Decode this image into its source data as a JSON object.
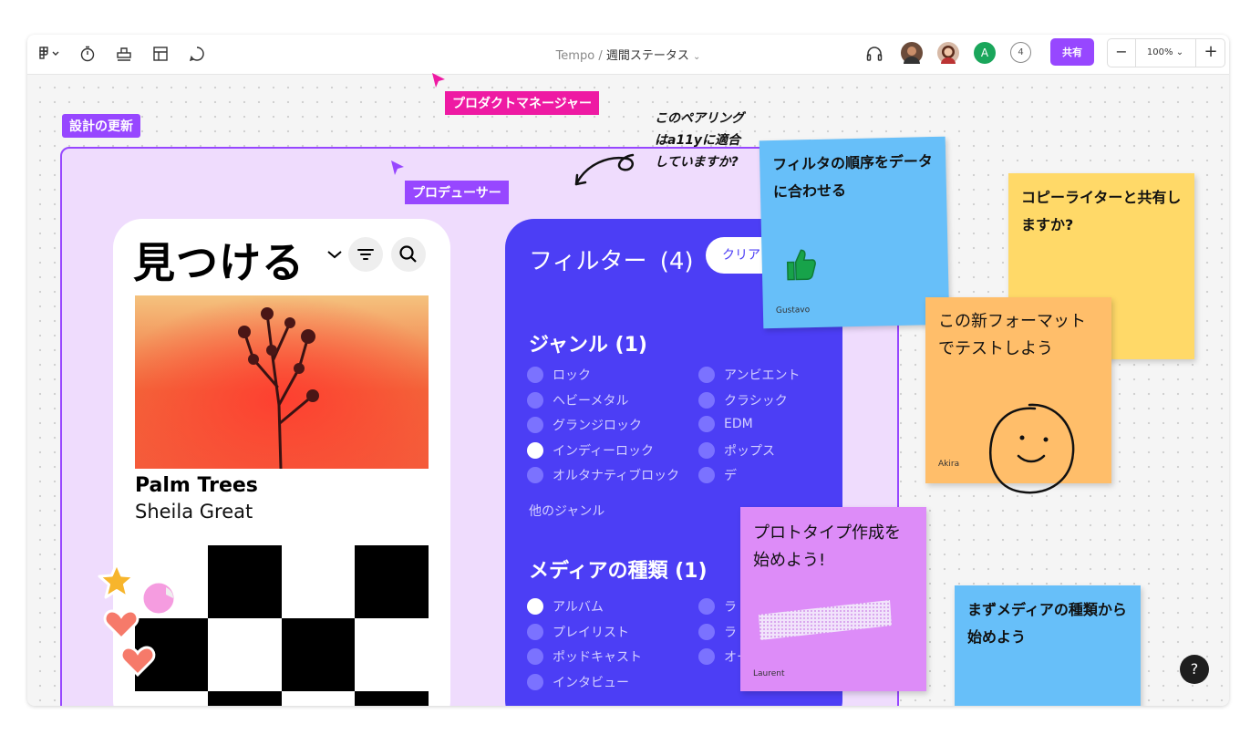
{
  "toolbar": {
    "file_name_prefix": "Tempo",
    "separator": "/",
    "file_name": "週間ステータス",
    "avatar_initial": "A",
    "viewer_count": "4",
    "share_label": "共有",
    "zoom_level": "100%",
    "zoom_out": "−",
    "zoom_in": "+"
  },
  "canvas": {
    "section_label": "設計の更新",
    "cursor_pm": "プロダクトマネージャー",
    "cursor_producer": "プロデューサー",
    "handwritten_note": [
      "このペアリング",
      "はa11yに適合",
      "していますか?"
    ]
  },
  "phone": {
    "heading": "見つける",
    "track_title": "Palm Trees",
    "track_artist": "Sheila Great"
  },
  "filter_panel": {
    "title": "フィルター",
    "count": "(4)",
    "clear_label": "クリア",
    "genre_heading": "ジャンル (1)",
    "genres_left": [
      {
        "label": "ロック",
        "on": false
      },
      {
        "label": "ヘビーメタル",
        "on": false
      },
      {
        "label": "グランジロック",
        "on": false
      },
      {
        "label": "インディーロック",
        "on": true
      },
      {
        "label": "オルタナティブロック",
        "on": false
      }
    ],
    "genres_right": [
      {
        "label": "アンビエント",
        "on": false
      },
      {
        "label": "クラシック",
        "on": false
      },
      {
        "label": "EDM",
        "on": false
      },
      {
        "label": "ポップス",
        "on": false
      },
      {
        "label": "デ",
        "on": false
      }
    ],
    "more_genres": "他のジャンル",
    "media_heading": "メディアの種類 (1)",
    "media_left": [
      {
        "label": "アルバム",
        "on": true
      },
      {
        "label": "プレイリスト",
        "on": false
      },
      {
        "label": "ポッドキャスト",
        "on": false
      },
      {
        "label": "インタビュー",
        "on": false
      }
    ],
    "media_right": [
      {
        "label": "ラ",
        "on": false
      },
      {
        "label": "ラ",
        "on": false
      },
      {
        "label": "オーディオブック",
        "on": false
      }
    ]
  },
  "stickies": {
    "blue_top": {
      "text": "フィルタの順序をデータに合わせる",
      "author": "Gustavo"
    },
    "yellow": {
      "text": "コピーライターと共有しますか?"
    },
    "orange": {
      "text": "この新フォーマットでテストしよう",
      "author": "Akira"
    },
    "purple": {
      "text": "プロトタイプ作成を始めよう!",
      "author": "Laurent"
    },
    "blue_bottom": {
      "text": "まずメディアの種類から始めよう"
    }
  },
  "help_label": "?",
  "colors": {
    "accent_purple": "#9747ff",
    "cursor_pink": "#ee1aa3",
    "filter_blue": "#4c3ef5",
    "sticky_blue": "#67bff9",
    "sticky_yellow": "#ffd968",
    "sticky_orange": "#ffbe6a",
    "sticky_purple": "#dd8cf8"
  }
}
